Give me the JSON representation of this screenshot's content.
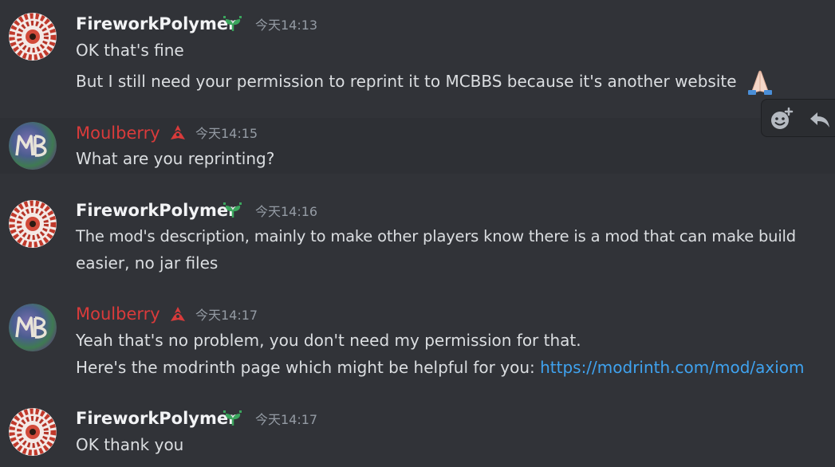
{
  "messages": [
    {
      "author": "FireworkPolymer",
      "timestamp": "今天14:13",
      "lines": [
        "OK that's fine",
        "But I still need your permission to reprint it to MCBBS because it's another website"
      ],
      "emoji": "folded-hands"
    },
    {
      "author": "Moulberry",
      "timestamp": "今天14:15",
      "lines": [
        "What are you reprinting?"
      ]
    },
    {
      "author": "FireworkPolymer",
      "timestamp": "今天14:16",
      "lines": [
        "The mod's description, mainly to make other players know there is a mod that can make build",
        "easier, no jar files"
      ]
    },
    {
      "author": "Moulberry",
      "timestamp": "今天14:17",
      "lines": [
        "Yeah that's no problem, you don't need my permission for that.",
        "Here's the modrinth page which might be helpful for you: "
      ],
      "link": "https://modrinth.com/mod/axiom"
    },
    {
      "author": "FireworkPolymer",
      "timestamp": "今天14:17",
      "lines": [
        "OK thank you"
      ]
    }
  ],
  "colors": {
    "background": "#313338",
    "hover_row": "#2e3035",
    "moulberry_name": "#d93b3b",
    "link": "#3fa3f0",
    "timestamp": "#949ba4"
  },
  "icons": {
    "fw_badge": "sprout-badge-icon",
    "ml_badge": "triskelion-badge-icon",
    "add_reaction": "add-reaction-icon",
    "reply": "reply-icon"
  }
}
